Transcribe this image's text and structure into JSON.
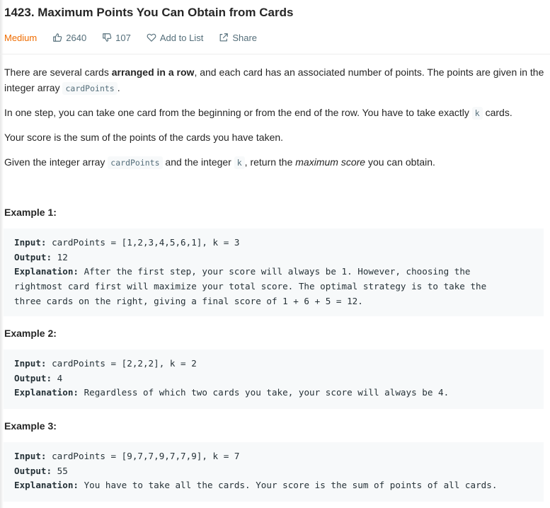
{
  "problem": {
    "title": "1423. Maximum Points You Can Obtain from Cards",
    "difficulty": "Medium",
    "likes": "2640",
    "dislikes": "107",
    "add_to_list": "Add to List",
    "share": "Share"
  },
  "description": {
    "p1": {
      "t1": "There are several cards ",
      "bold": "arranged in a row",
      "t2": ", and each card has an associated number of points. The points are given in the integer array ",
      "code": "cardPoints",
      "t3": "."
    },
    "p2": {
      "t1": "In one step, you can take one card from the beginning or from the end of the row. You have to take exactly ",
      "code": "k",
      "t2": " cards."
    },
    "p3": "Your score is the sum of the points of the cards you have taken.",
    "p4": {
      "t1": "Given the integer array ",
      "code1": "cardPoints",
      "t2": " and the integer ",
      "code2": "k",
      "t3": ", return the ",
      "em": "maximum score",
      "t4": " you can obtain."
    }
  },
  "examples": [
    {
      "heading": "Example 1:",
      "input_label": "Input:",
      "input": " cardPoints = [1,2,3,4,5,6,1], k = 3",
      "output_label": "Output:",
      "output": " 12",
      "explanation_label": "Explanation:",
      "explanation_line1": " After the first step, your score will always be 1. However, choosing the",
      "explanation_line2": "rightmost card first will maximize your total score. The optimal strategy is to take the",
      "explanation_line3": "three cards on the right, giving a final score of 1 + 6 + 5 = 12."
    },
    {
      "heading": "Example 2:",
      "input_label": "Input:",
      "input": " cardPoints = [2,2,2], k = 2",
      "output_label": "Output:",
      "output": " 4",
      "explanation_label": "Explanation:",
      "explanation_line1": " Regardless of which two cards you take, your score will always be 4."
    },
    {
      "heading": "Example 3:",
      "input_label": "Input:",
      "input": " cardPoints = [9,7,7,9,7,7,9], k = 7",
      "output_label": "Output:",
      "output": " 55",
      "explanation_label": "Explanation:",
      "explanation_line1": " You have to take all the cards. Your score is the sum of points of all cards."
    }
  ],
  "icons": {
    "like": "thumbs-up-icon",
    "dislike": "thumbs-down-icon",
    "add_to_list": "heart-icon",
    "share": "share-icon"
  },
  "colors": {
    "difficulty_medium": "#ef6c00",
    "meta_text": "#546e7a",
    "example_bg": "#f7f9fa"
  }
}
